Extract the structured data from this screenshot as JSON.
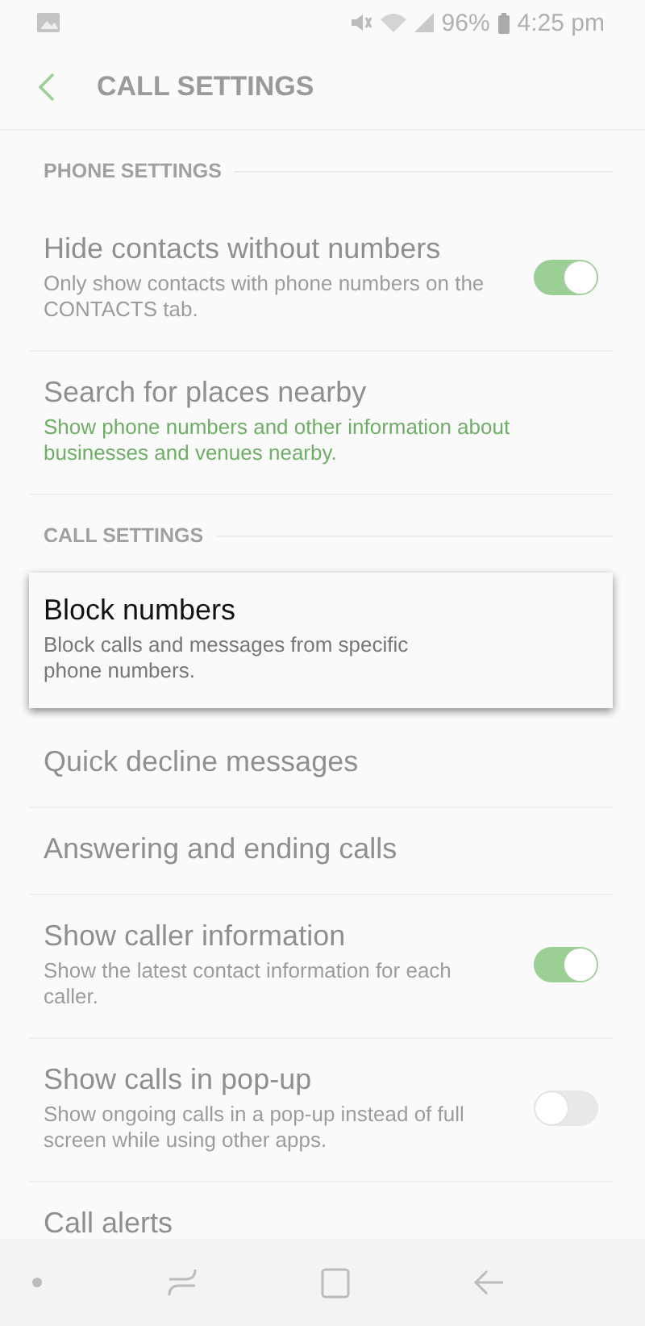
{
  "status_bar": {
    "battery": "96%",
    "time": "4:25 pm"
  },
  "header": {
    "title": "CALL SETTINGS"
  },
  "sections": [
    {
      "title": "PHONE SETTINGS",
      "items": [
        {
          "title": "Hide contacts without numbers",
          "subtitle": "Only show contacts with phone numbers on the CONTACTS tab.",
          "accent": false,
          "highlighted": false,
          "kind": "toggle",
          "on": true
        },
        {
          "title": "Search for places nearby",
          "subtitle": "Show phone numbers and other information about businesses and venues nearby.",
          "accent": true,
          "highlighted": false,
          "kind": "link"
        }
      ]
    },
    {
      "title": "CALL SETTINGS",
      "items": [
        {
          "title": "Block numbers",
          "subtitle": "Block calls and messages from specific phone numbers.",
          "accent": false,
          "highlighted": true,
          "kind": "link"
        },
        {
          "title": "Quick decline messages",
          "highlighted": false,
          "kind": "link"
        },
        {
          "title": "Answering and ending calls",
          "highlighted": false,
          "kind": "link"
        },
        {
          "title": "Show caller information",
          "subtitle": "Show the latest contact information for each caller.",
          "accent": false,
          "highlighted": false,
          "kind": "toggle",
          "on": true
        },
        {
          "title": "Show calls in pop-up",
          "subtitle": "Show ongoing calls in a pop-up instead of full screen while using other apps.",
          "accent": false,
          "highlighted": false,
          "kind": "toggle",
          "on": false
        },
        {
          "title": "Call alerts",
          "highlighted": false,
          "kind": "link"
        }
      ]
    }
  ]
}
